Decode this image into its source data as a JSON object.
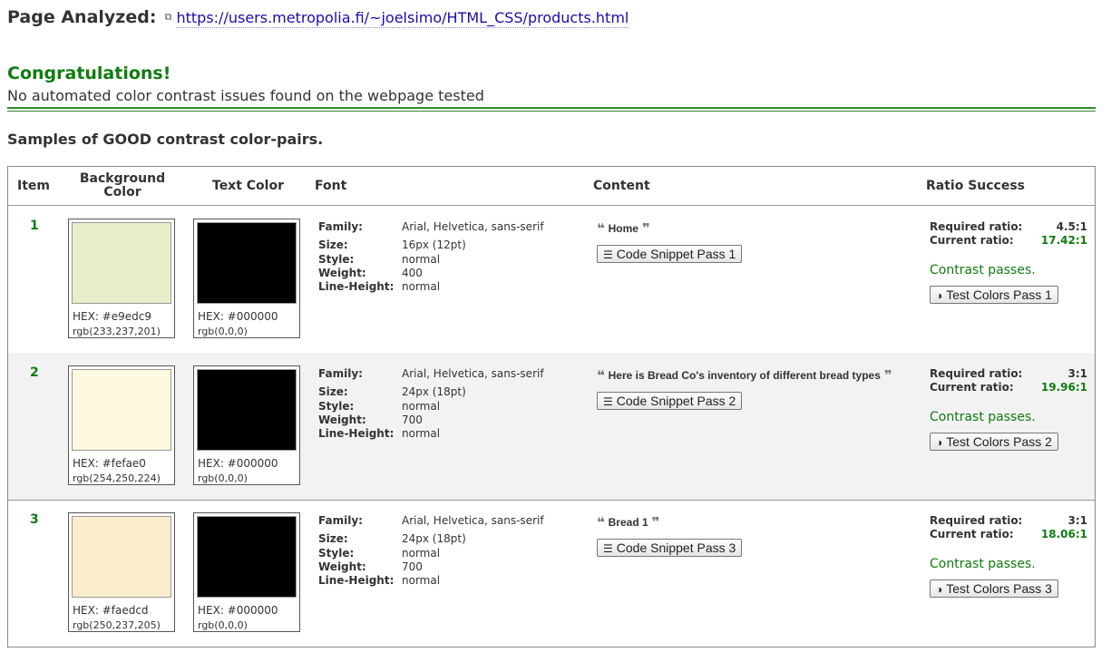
{
  "header": {
    "label": "Page Analyzed:",
    "url_icon": "external-window-icon",
    "url": "https://users.metropolia.fi/~joelsimo/HTML_CSS/products.html"
  },
  "result": {
    "title": "Congratulations!",
    "message": "No automated color contrast issues found on the webpage tested"
  },
  "samples_title": "Samples of GOOD contrast color-pairs.",
  "table": {
    "headers": {
      "item": "Item",
      "background_color": "Background Color",
      "text_color": "Text Color",
      "font": "Font",
      "content": "Content",
      "ratio_success": "Ratio Success"
    },
    "font_labels": {
      "family": "Family:",
      "size": "Size:",
      "style": "Style:",
      "weight": "Weight:",
      "line_height": "Line-Height:"
    },
    "ratio_labels": {
      "required": "Required ratio:",
      "current": "Current ratio:"
    },
    "rows": [
      {
        "item": "1",
        "bg_color": "#e9edc9",
        "bg_hex": "HEX: #e9edc9",
        "bg_rgb": "rgb(233,237,201)",
        "fg_color": "#000000",
        "fg_hex": "HEX: #000000",
        "fg_rgb": "rgb(0,0,0)",
        "family": "Arial, Helvetica, sans-serif",
        "size": "16px (12pt)",
        "style": "normal",
        "weight": "400",
        "line_height": "normal",
        "content": "Home",
        "snippet_button": "Code Snippet Pass 1",
        "required_ratio": "4.5:1",
        "current_ratio": "17.42:1",
        "status": "Contrast passes.",
        "test_button": "Test Colors Pass 1"
      },
      {
        "item": "2",
        "bg_color": "#fefae0",
        "bg_hex": "HEX: #fefae0",
        "bg_rgb": "rgb(254,250,224)",
        "fg_color": "#000000",
        "fg_hex": "HEX: #000000",
        "fg_rgb": "rgb(0,0,0)",
        "family": "Arial, Helvetica, sans-serif",
        "size": "24px (18pt)",
        "style": "normal",
        "weight": "700",
        "line_height": "normal",
        "content": "Here is Bread Co's inventory of different bread types",
        "snippet_button": "Code Snippet Pass 2",
        "required_ratio": "3:1",
        "current_ratio": "19.96:1",
        "status": "Contrast passes.",
        "test_button": "Test Colors Pass 2"
      },
      {
        "item": "3",
        "bg_color": "#faedcd",
        "bg_hex": "HEX: #faedcd",
        "bg_rgb": "rgb(250,237,205)",
        "fg_color": "#000000",
        "fg_hex": "HEX: #000000",
        "fg_rgb": "rgb(0,0,0)",
        "family": "Arial, Helvetica, sans-serif",
        "size": "24px (18pt)",
        "style": "normal",
        "weight": "700",
        "line_height": "normal",
        "content": "Bread 1",
        "snippet_button": "Code Snippet Pass 3",
        "required_ratio": "3:1",
        "current_ratio": "18.06:1",
        "status": "Contrast passes.",
        "test_button": "Test Colors Pass 3"
      }
    ]
  },
  "icons": {
    "quote_open": "left-quote-icon",
    "quote_close": "right-quote-icon",
    "snippet": "lines-icon",
    "contrast": "half-circle-contrast-icon"
  },
  "colors": {
    "success_green": "#107c10",
    "link_blue": "#1a0dab",
    "alt_row": "#f2f2f2"
  }
}
